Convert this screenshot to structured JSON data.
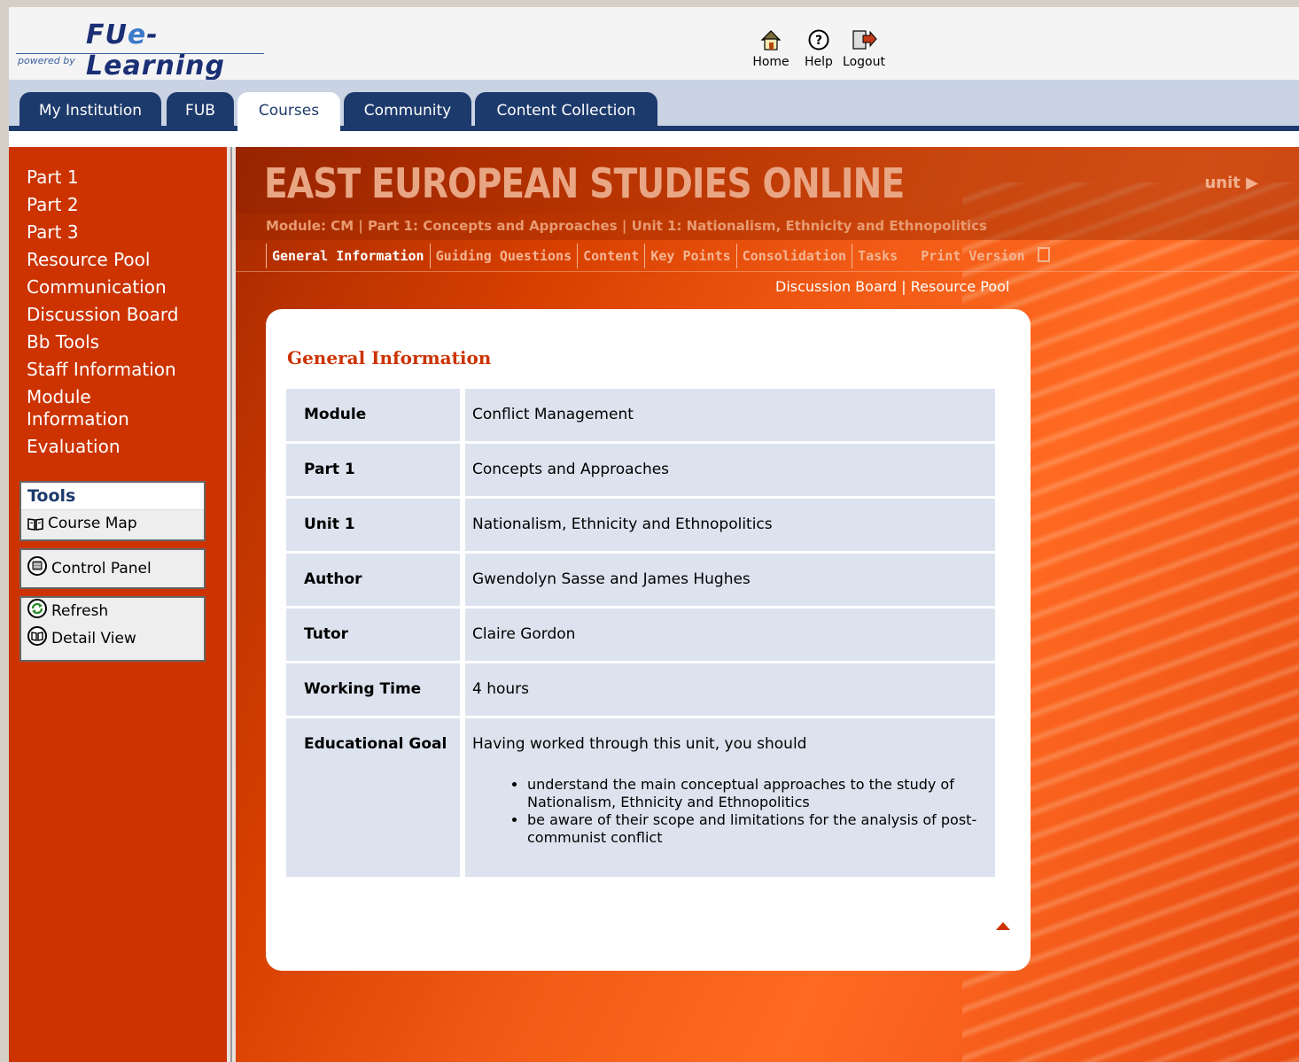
{
  "header": {
    "brand_prefix": "FU",
    "brand_e": "e",
    "brand_suffix": "-Learning",
    "powered": "powered by",
    "nav": {
      "home": "Home",
      "help": "Help",
      "logout": "Logout"
    }
  },
  "tabs": [
    "My Institution",
    "FUB",
    "Courses",
    "Community",
    "Content Collection"
  ],
  "sidebar": {
    "items": [
      "Part 1",
      "Part 2",
      "Part 3",
      "Resource Pool",
      "Communication",
      "Discussion Board",
      "Bb Tools",
      "Staff Information",
      "Module Information",
      "Evaluation"
    ],
    "tools_title": "Tools",
    "course_map": "Course Map",
    "control_panel": "Control Panel",
    "refresh": "Refresh",
    "detail_view": "Detail View"
  },
  "main": {
    "site_title": "EAST EUROPEAN STUDIES ONLINE",
    "unit_link": "unit",
    "breadcrumb": "Module: CM | Part 1: Concepts and Approaches | Unit 1: Nationalism, Ethnicity and Ethnopolitics",
    "subnav": [
      "General Information",
      "Guiding Questions",
      "Content",
      "Key Points",
      "Consolidation",
      "Tasks"
    ],
    "print_version": "Print Version",
    "links": {
      "discussion_board": "Discussion Board",
      "separator": "|",
      "resource_pool": "Resource Pool"
    },
    "card_title": "General Information",
    "rows": [
      {
        "key": "Module",
        "value": "Conflict Management"
      },
      {
        "key": "Part 1",
        "value": "Concepts and Approaches"
      },
      {
        "key": "Unit 1",
        "value": "Nationalism, Ethnicity and Ethnopolitics"
      },
      {
        "key": "Author",
        "value": "Gwendolyn Sasse and James Hughes"
      },
      {
        "key": "Tutor",
        "value": "Claire Gordon"
      },
      {
        "key": "Working Time",
        "value": "4 hours"
      }
    ],
    "goal": {
      "key": "Educational Goal",
      "intro": "Having worked through this unit, you should",
      "bullets": [
        "understand the main conceptual approaches to the study of Nationalism, Ethnicity and Ethnopolitics",
        "be aware of their scope and limitations for the analysis of post-communist conflict"
      ]
    }
  },
  "colors": {
    "sidebar": "#cc3300",
    "tab_dark": "#1d3a6c",
    "table_cell": "#dde3ee",
    "heading": "#cc3300"
  }
}
